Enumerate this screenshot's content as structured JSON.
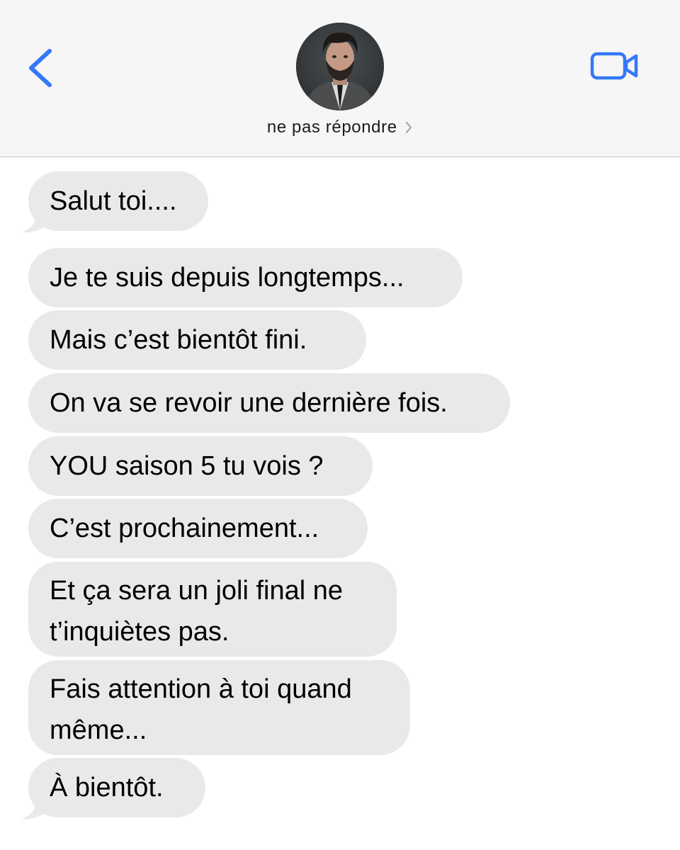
{
  "header": {
    "contact_name": "ne pas répondre",
    "back_icon": "chevron-left-icon",
    "video_icon": "video-camera-icon",
    "accent_color": "#3478f6"
  },
  "messages": [
    {
      "text": "Salut toi...."
    },
    {
      "text": "Je te suis depuis longtemps..."
    },
    {
      "text": "Mais c’est bientôt fini."
    },
    {
      "text": "On va se revoir une dernière fois."
    },
    {
      "text": "YOU saison 5 tu vois ?"
    },
    {
      "text": "C’est prochainement..."
    },
    {
      "line1": "Et ça sera un joli final ne",
      "line2": "t’inquiètes pas."
    },
    {
      "line1": "Fais attention à toi quand",
      "line2": "même..."
    },
    {
      "text": "À bientôt."
    }
  ],
  "colors": {
    "header_bg": "#f6f6f6",
    "received_bubble": "#e9e9eb",
    "text": "#000000"
  }
}
